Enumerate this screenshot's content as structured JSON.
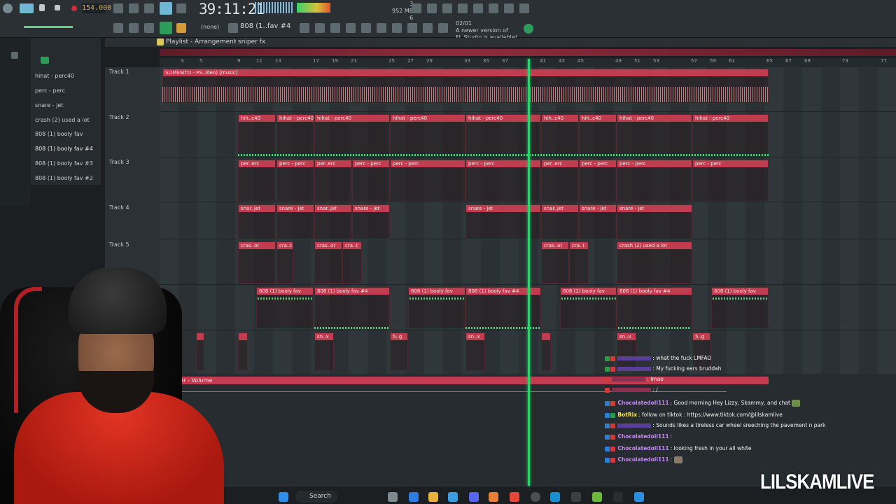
{
  "toolbar": {
    "tempo": "154.000",
    "time": "39:11:21",
    "none_label": "(none)",
    "pattern": "808 (1..fav #4",
    "memory": "952 MB",
    "cpu_label": "6",
    "cpu_val": "3",
    "news_date": "02/01",
    "news_line1": "A newer version of",
    "news_line2": "FL Studio is available!"
  },
  "browser": {
    "items": [
      "hihat - perc40",
      "perc - perc",
      "snare - jet",
      "crash (2) used a lot",
      "808 (1) booly fav",
      "808 (1) booly fav #4",
      "808 (1) booly fav #3",
      "808 (1) booly fav #2"
    ]
  },
  "playlist": {
    "title": "Playlist - Arrangement",
    "pattern": "sniper fx",
    "ruler": [
      "3",
      "5",
      "9",
      "11",
      "13",
      "17",
      "19",
      "21",
      "25",
      "27",
      "29",
      "33",
      "35",
      "37",
      "41",
      "43",
      "45",
      "49",
      "51",
      "53",
      "57",
      "59",
      "61",
      "65",
      "67",
      "69",
      "73",
      "77"
    ],
    "tracks": [
      "Track 1",
      "Track 2",
      "Track 3",
      "Track 4",
      "Track 5"
    ],
    "track1_clip": "SLIMESITO - PS..ideo) [music]",
    "track2_clip": "hihat - perc40",
    "track2_short": "hih..c40",
    "track3_clip": "perc - perc",
    "track3_short": "per..erc",
    "track4_clip": "snare - jet",
    "track4_short": "snar..jet",
    "track5_clip": "crash (2) used a lot",
    "track5_short": "cras..ot",
    "track5_short2": "cra..t",
    "bass_clip": "808 (1) booly fav",
    "bass_clip4": "808 (1) booly fav #4",
    "fx_clip1": "sn..x",
    "fx_clip2": "5..g",
    "automation": "ster - Volume"
  },
  "chat": {
    "messages": [
      {
        "user": "",
        "msg": ": what the fuck LMFAO",
        "color": "#7d5bd6"
      },
      {
        "user": "",
        "msg": ": My fucking ears bruddah",
        "color": "#7d5bd6"
      },
      {
        "user": "",
        "msg": ": lmao",
        "color": "#b0406a"
      },
      {
        "user": "",
        "msg": ": ∕",
        "color": "#b0406a"
      },
      {
        "user": "Chocolatedoll111",
        "msg": ": Good morning Hey Lizzy, Skammy, and chat",
        "color": "#c58bf2"
      },
      {
        "user": "BotRix",
        "msg": ": follow on tiktok : https://www.tiktok.com/@lilskamlive",
        "color": "#ffe14a"
      },
      {
        "user": "",
        "msg": ": Sounds likes a tireless car wheel sreeching the pavement n park",
        "color": "#7d5bd6"
      },
      {
        "user": "Chocolatedoll111",
        "msg": ":",
        "color": "#c58bf2"
      },
      {
        "user": "Chocolatedoll111",
        "msg": ": looking fresh in your all white",
        "color": "#c58bf2"
      },
      {
        "user": "Chocolatedoll111",
        "msg": ":",
        "color": "#c58bf2"
      }
    ]
  },
  "taskbar": {
    "search": "Search"
  },
  "overlay": {
    "channel": "LILSKAMLIVE"
  }
}
